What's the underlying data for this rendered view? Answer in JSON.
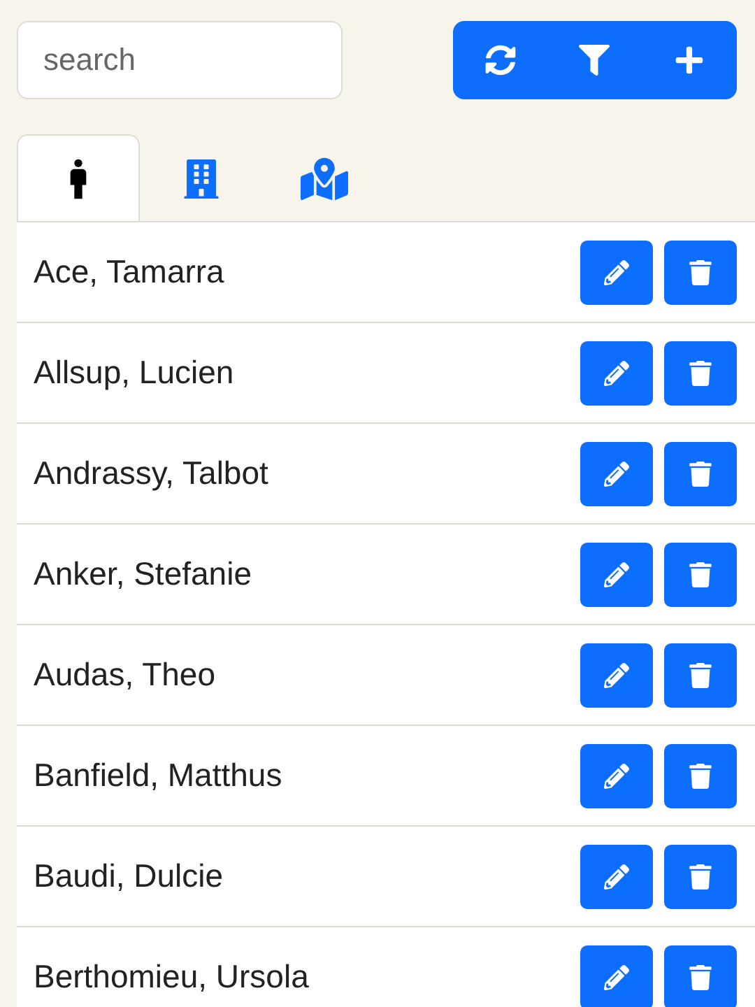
{
  "search": {
    "placeholder": "search"
  },
  "toolbar": {
    "buttons": [
      {
        "kind": "refresh"
      },
      {
        "kind": "filter"
      },
      {
        "kind": "add"
      }
    ]
  },
  "tabs": [
    {
      "kind": "person",
      "selected": true
    },
    {
      "kind": "building",
      "selected": false
    },
    {
      "kind": "map",
      "selected": false
    }
  ],
  "rows": [
    {
      "name": "Ace, Tamarra"
    },
    {
      "name": "Allsup, Lucien"
    },
    {
      "name": "Andrassy, Talbot"
    },
    {
      "name": "Anker, Stefanie"
    },
    {
      "name": "Audas, Theo"
    },
    {
      "name": "Banfield, Matthus"
    },
    {
      "name": "Baudi, Dulcie"
    },
    {
      "name": "Berthomieu, Ursola"
    }
  ]
}
